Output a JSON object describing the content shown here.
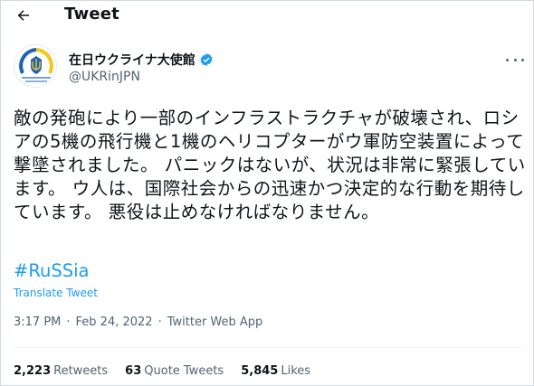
{
  "header": {
    "title": "Tweet",
    "back_icon": "arrow-left-icon"
  },
  "author": {
    "display_name": "在日ウクライナ大使館",
    "handle": "@UKRinJPN",
    "verified": true,
    "avatar_caption": "Ukrainian Embassy Tokyo",
    "colors": {
      "blue": "#1e63b3",
      "yellow": "#f5c518",
      "verified": "#1d9bf0"
    }
  },
  "tweet": {
    "text": "敵の発砲により一部のインフラストラクチャが破壊され、ロシアの5機の飛行機と1機のヘリコプターがウ軍防空装置によって撃墜されました。 パニックはないが、状況は非常に緊張しています。 ウ人は、国際社会からの迅速かつ決定的な行動を期待しています。 悪役は止めなければなりません。",
    "hashtag": "#RuSSia",
    "translate_label": "Translate Tweet",
    "time": "3:17 PM",
    "date": "Feb 24, 2022",
    "source": "Twitter Web App",
    "separator": "·"
  },
  "stats": {
    "retweets_count": "2,223",
    "retweets_label": "Retweets",
    "quotes_count": "63",
    "quotes_label": "Quote Tweets",
    "likes_count": "5,845",
    "likes_label": "Likes"
  }
}
